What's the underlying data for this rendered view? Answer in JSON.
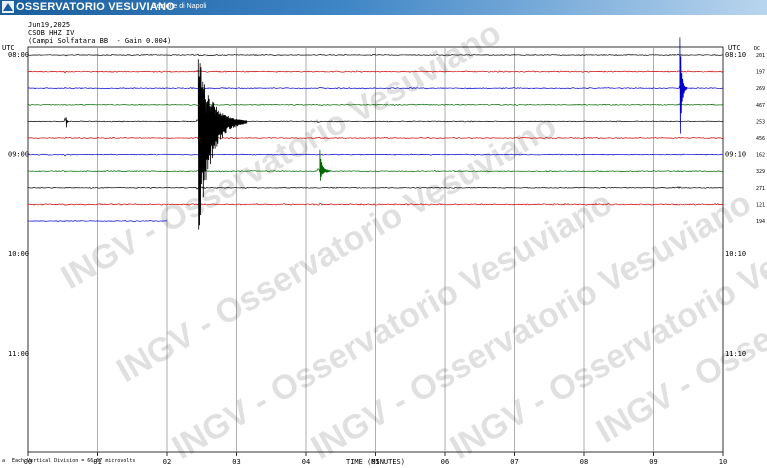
{
  "header": {
    "brand": "OSSERVATORIO VESUVIANO",
    "section": "Sezione di Napoli",
    "logo_icon": "ingv-logo-icon"
  },
  "info": {
    "date": "Jun19,2025",
    "station": "CSOB HHZ IV",
    "location_gain": "(Campi Solfatara BB  - Gain 0.004)"
  },
  "chart_data": {
    "type": "line",
    "title": "",
    "xlabel": "TIME (MINUTES)",
    "x_tick_labels": [
      "00",
      "01",
      "02",
      "03",
      "04",
      "05",
      "06",
      "07",
      "08",
      "09",
      "10"
    ],
    "x_range": [
      0,
      10
    ],
    "left_axis": {
      "header": "UTC",
      "times": [
        {
          "label": "08:00",
          "trace_index": 0
        },
        {
          "label": "09:00",
          "trace_index": 6
        },
        {
          "label": "10:00",
          "trace_index": 12
        },
        {
          "label": "11:00",
          "trace_index": 18
        }
      ]
    },
    "right_axis": {
      "header": "UTC",
      "unit": "DC",
      "times": [
        {
          "label": "08:10",
          "trace_index": 0
        },
        {
          "label": "09:10",
          "trace_index": 6
        },
        {
          "label": "10:10",
          "trace_index": 12
        },
        {
          "label": "11:10",
          "trace_index": 18
        }
      ]
    },
    "trace_colors": [
      "#000000",
      "#cc0000",
      "#0000cc",
      "#006600"
    ],
    "series": [
      {
        "trace_index": 0,
        "color": "#000000",
        "dc_offset": "201",
        "x_end": 10,
        "noise": 0.7
      },
      {
        "trace_index": 1,
        "color": "#cc0000",
        "dc_offset": "197",
        "x_end": 10,
        "noise": 0.9
      },
      {
        "trace_index": 2,
        "color": "#0000cc",
        "dc_offset": "269",
        "x_end": 10,
        "noise": 0.8
      },
      {
        "trace_index": 3,
        "color": "#006600",
        "dc_offset": "467",
        "x_end": 10,
        "noise": 0.8
      },
      {
        "trace_index": 4,
        "color": "#000000",
        "dc_offset": "253",
        "x_end": 10,
        "noise": 0.7
      },
      {
        "trace_index": 5,
        "color": "#cc0000",
        "dc_offset": "456",
        "x_end": 10,
        "noise": 0.8
      },
      {
        "trace_index": 6,
        "color": "#0000cc",
        "dc_offset": "162",
        "x_end": 10,
        "noise": 0.7
      },
      {
        "trace_index": 7,
        "color": "#006600",
        "dc_offset": "329",
        "x_end": 10,
        "noise": 0.8
      },
      {
        "trace_index": 8,
        "color": "#000000",
        "dc_offset": "271",
        "x_end": 10,
        "noise": 0.7
      },
      {
        "trace_index": 9,
        "color": "#cc0000",
        "dc_offset": "121",
        "x_end": 10,
        "noise": 1.0
      },
      {
        "trace_index": 10,
        "color": "#0000cc",
        "dc_offset": "194",
        "x_end": 2.0,
        "noise": 0.6
      }
    ],
    "events": [
      {
        "trace_index": 4,
        "x": 2.45,
        "amp_up_traces": 4.1,
        "amp_down_traces": 7.3,
        "duration_min": 0.7,
        "color": "#000000"
      },
      {
        "trace_index": 2,
        "x": 9.38,
        "amp_up_traces": 3.5,
        "amp_down_traces": 4.0,
        "duration_min": 0.1,
        "color": "#0000cc"
      },
      {
        "trace_index": 7,
        "x": 4.2,
        "amp_up_traces": 1.4,
        "amp_down_traces": 0.7,
        "duration_min": 0.15,
        "color": "#006600"
      },
      {
        "trace_index": 4,
        "x": 0.55,
        "amp_up_traces": 0.3,
        "amp_down_traces": 0.5,
        "duration_min": 0.03,
        "color": "#000000"
      }
    ],
    "grid": true,
    "footer_note": "Each Vertical Division =    66.67 microvolts",
    "footer_mark": "a"
  },
  "watermark": "INGV - Osservatorio Vesuviano"
}
